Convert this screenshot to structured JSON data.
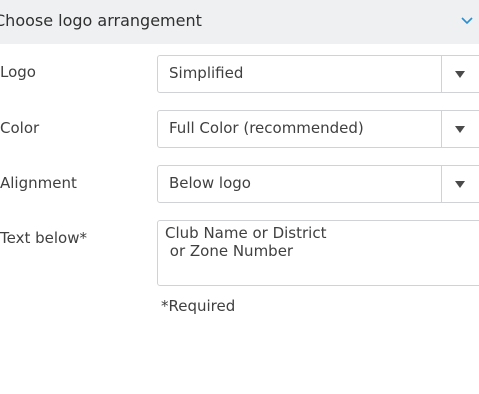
{
  "header": {
    "title": "Choose logo arrangement",
    "toggle_icon": "chevron-down-icon",
    "accent_color": "#2a8ed0",
    "background": "#eef0f2"
  },
  "fields": {
    "logo": {
      "label": "Logo",
      "value": "Simplified"
    },
    "color": {
      "label": "Color",
      "value": "Full Color (recommended)"
    },
    "alignment": {
      "label": "Alignment",
      "value": "Below logo"
    },
    "text_below": {
      "label": "Text below*",
      "value": "Club Name or District\n or Zone Number"
    }
  },
  "required_note": "*Required"
}
